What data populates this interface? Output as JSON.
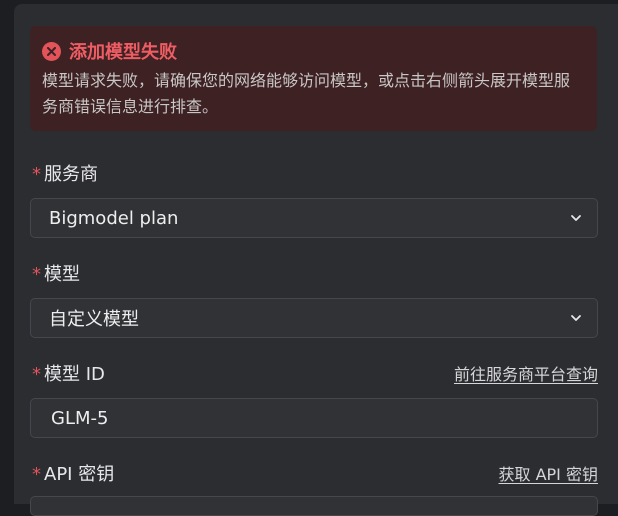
{
  "error": {
    "title": "添加模型失败",
    "message": "模型请求失败，请确保您的网络能够访问模型，或点击右侧箭头展开模型服务商错误信息进行排查。",
    "icon": "error-circle-icon",
    "color": "#e2535a"
  },
  "provider": {
    "required_mark": "*",
    "label": "服务商",
    "selected": "Bigmodel plan"
  },
  "model": {
    "required_mark": "*",
    "label": "模型",
    "selected": "自定义模型"
  },
  "model_id": {
    "required_mark": "*",
    "label": "模型 ID",
    "link": "前往服务商平台查询",
    "value": "GLM-5"
  },
  "api_key": {
    "required_mark": "*",
    "label": "API 密钥",
    "link": "获取 API 密钥"
  },
  "colors": {
    "background": "#2b2d31",
    "error_background": "#3d2123",
    "required": "#e2535a"
  }
}
